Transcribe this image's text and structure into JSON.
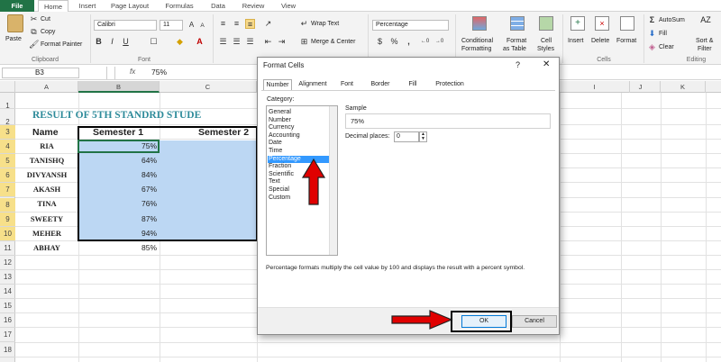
{
  "tabs": {
    "file": "File",
    "home": "Home",
    "insert": "Insert",
    "page_layout": "Page Layout",
    "formulas": "Formulas",
    "data": "Data",
    "review": "Review",
    "view": "View"
  },
  "ribbon": {
    "clipboard": {
      "paste": "Paste",
      "cut": "Cut",
      "copy": "Copy",
      "format_painter": "Format Painter",
      "group": "Clipboard"
    },
    "font": {
      "font_name": "Calibri",
      "font_size": "11",
      "group": "Font"
    },
    "alignment": {
      "wrap_text": "Wrap Text",
      "merge_center": "Merge & Center"
    },
    "number": {
      "format": "Percentage",
      "currency": "$",
      "percent": "%",
      "comma": ","
    },
    "styles": {
      "conditional": "Conditional",
      "conditional2": "Formatting",
      "format_table": "Format",
      "format_table2": "as Table",
      "cell_styles": "Cell",
      "cell_styles2": "Styles"
    },
    "cells": {
      "insert": "Insert",
      "delete": "Delete",
      "format": "Format",
      "group": "Cells"
    },
    "editing": {
      "autosum": "AutoSum",
      "fill": "Fill",
      "clear": "Clear",
      "sort": "Sort &",
      "sort2": "Filter",
      "group": "Editing"
    }
  },
  "formula_bar": {
    "name_box": "B3",
    "fx": "fx",
    "value": "75%"
  },
  "columns": [
    "A",
    "B",
    "C",
    "D",
    "E",
    "F",
    "G",
    "H",
    "I",
    "J",
    "K"
  ],
  "rows": [
    "1",
    "2",
    "3",
    "4",
    "5",
    "6",
    "7",
    "8",
    "9",
    "10",
    "11",
    "12",
    "13",
    "14",
    "15",
    "16",
    "17",
    "18"
  ],
  "sheet": {
    "title": "RESULT OF 5TH STANDRD STUDE",
    "header_name": "Name",
    "header_sem1": "Semester 1",
    "header_sem2": "Semester 2",
    "students": [
      {
        "name": "RIA",
        "sem1": "75%"
      },
      {
        "name": "TANISHQ",
        "sem1": "64%"
      },
      {
        "name": "DIVYANSH",
        "sem1": "84%"
      },
      {
        "name": "AKASH",
        "sem1": "67%"
      },
      {
        "name": "TINA",
        "sem1": "76%"
      },
      {
        "name": "SWEETY",
        "sem1": "87%"
      },
      {
        "name": "MEHER",
        "sem1": "94%"
      },
      {
        "name": "ABHAY",
        "sem1": "85%"
      }
    ]
  },
  "dialog": {
    "title": "Format Cells",
    "help": "?",
    "close": "✕",
    "tabs": [
      "Number",
      "Alignment",
      "Font",
      "Border",
      "Fill",
      "Protection"
    ],
    "category_label": "Category:",
    "categories": [
      "General",
      "Number",
      "Currency",
      "Accounting",
      "Date",
      "Time",
      "Percentage",
      "Fraction",
      "Scientific",
      "Text",
      "Special",
      "Custom"
    ],
    "selected_category": "Percentage",
    "sample_label": "Sample",
    "sample_value": "75%",
    "decimal_label": "Decimal places:",
    "decimal_value": "0",
    "description": "Percentage formats multiply the cell value by 100 and displays the result with a percent symbol.",
    "ok": "OK",
    "cancel": "Cancel"
  },
  "colors": {
    "excel_green": "#217346",
    "selection": "#bcd7f3",
    "arrow_red": "#e00000",
    "title_teal": "#2e8b9a"
  }
}
